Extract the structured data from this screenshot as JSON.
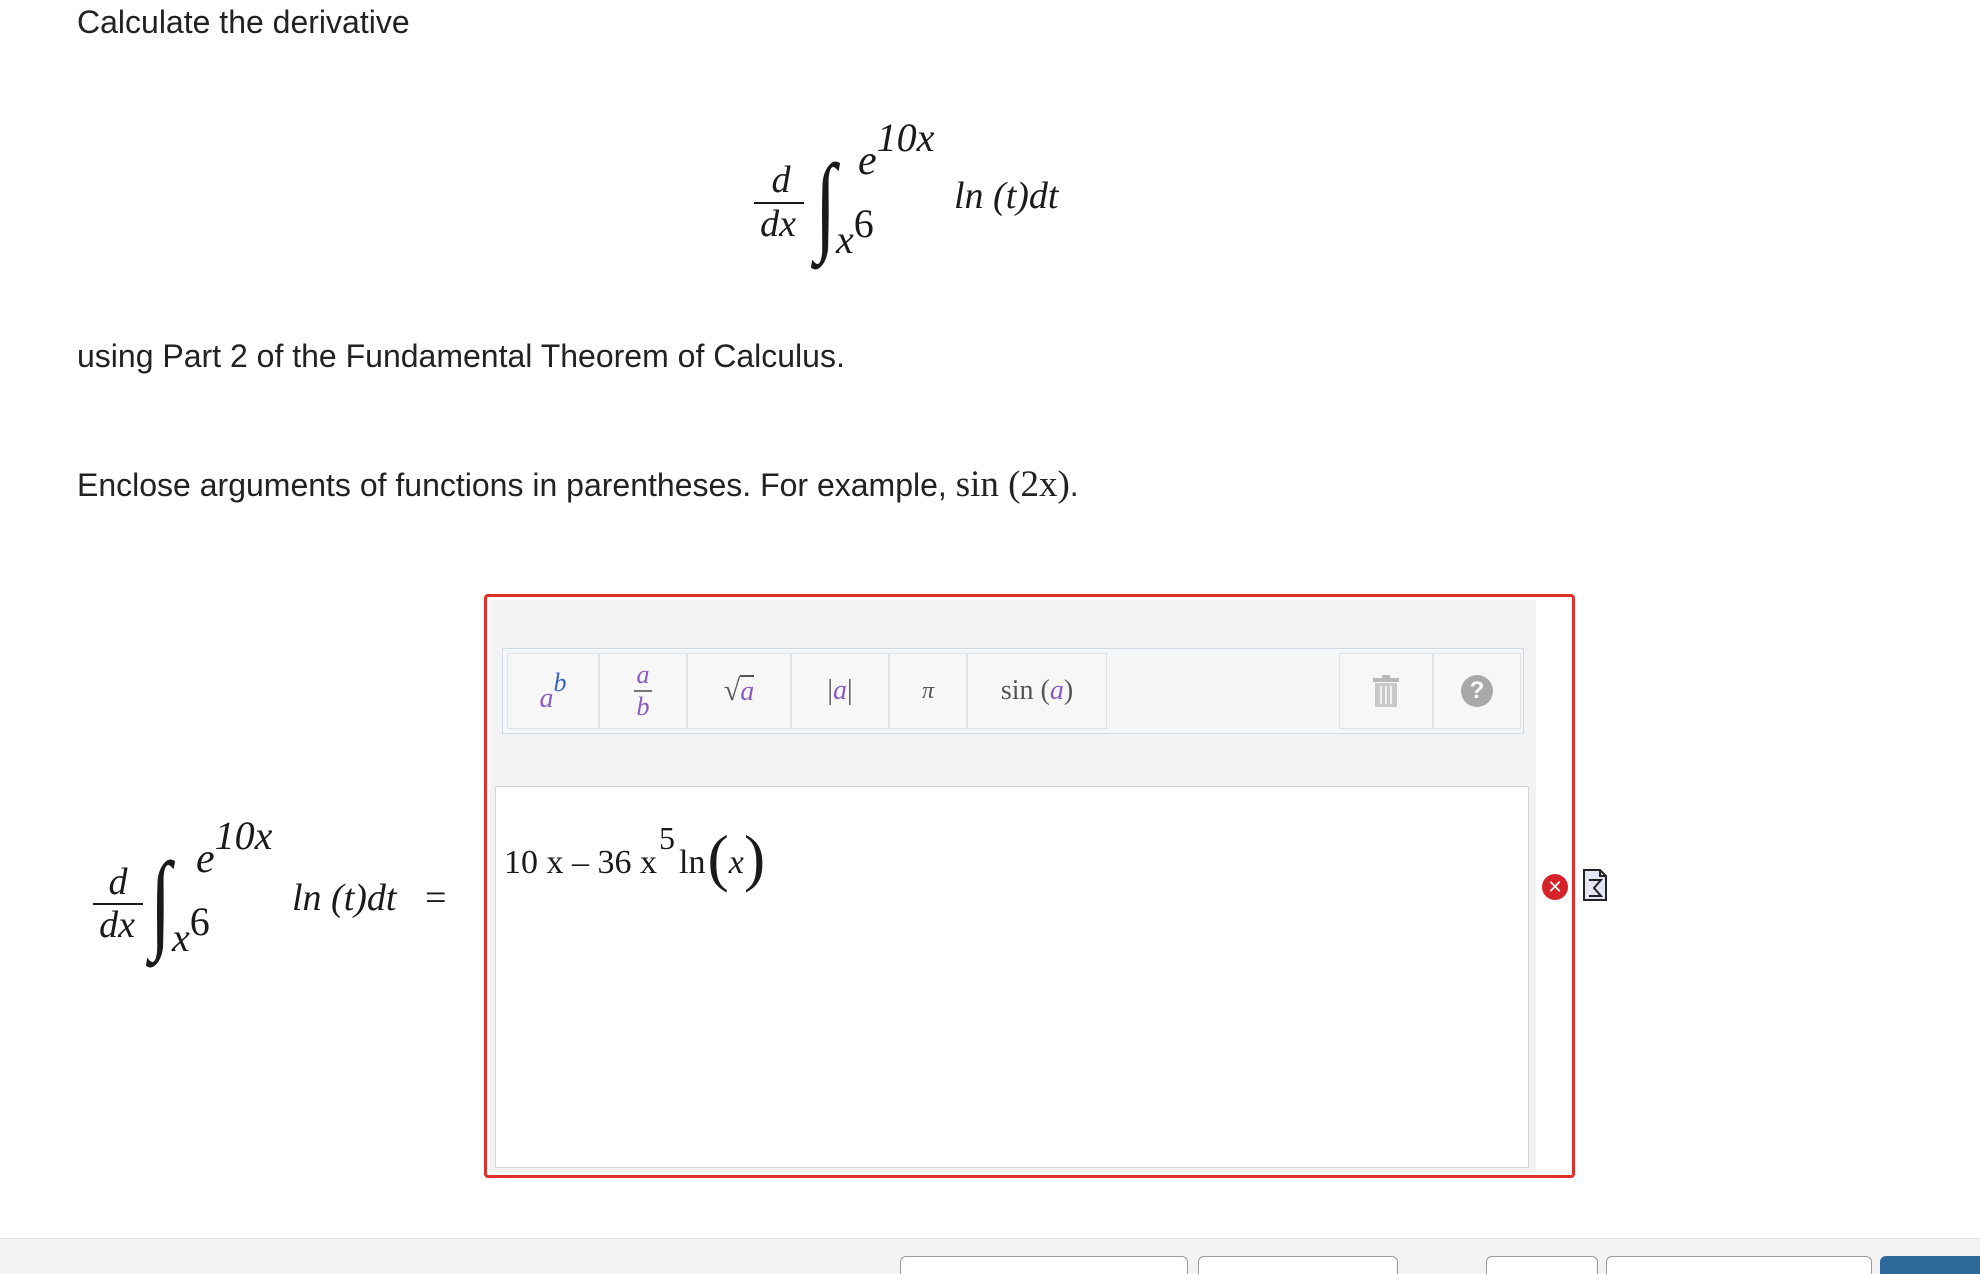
{
  "prompt": {
    "title": "Calculate the derivative",
    "theorem_line": "using Part 2 of the Fundamental Theorem of Calculus.",
    "instruction_prefix": "Enclose arguments of functions in parentheses. For example, ",
    "instruction_example": "sin (2x)",
    "instruction_suffix": "."
  },
  "expression": {
    "d_num": "d",
    "d_den": "dx",
    "integral_sign": "∫",
    "upper_limit": "e^{10x}",
    "upper_base": "e",
    "upper_exp": "10x",
    "lower_limit": "x^6",
    "lower_base": "x",
    "lower_exp": "6",
    "integrand": "ln (t)dt",
    "equals": "="
  },
  "toolbar": {
    "buttons": [
      {
        "name": "power",
        "label": "a^b"
      },
      {
        "name": "fraction",
        "label": "a/b"
      },
      {
        "name": "sqrt",
        "label": "√a"
      },
      {
        "name": "abs",
        "label": "|a|"
      },
      {
        "name": "pi",
        "label": "π"
      },
      {
        "name": "sin",
        "label": "sin (a)"
      },
      {
        "name": "trash",
        "icon": "trash-icon"
      },
      {
        "name": "help",
        "label": "?"
      }
    ]
  },
  "answer": {
    "current_value": "10 x – 36 x^5 ln(x)",
    "part1": "10 x – 36 x",
    "exp": "5",
    "part2": "ln",
    "arg": "x",
    "status": "incorrect"
  },
  "icons": {
    "status_icon": "x-circle-icon",
    "preview_icon": "sigma-document-icon"
  },
  "colors": {
    "error_border": "#e0302a",
    "toolbar_bg": "#f4f6f8",
    "primary_button": "#2d6a9a"
  }
}
